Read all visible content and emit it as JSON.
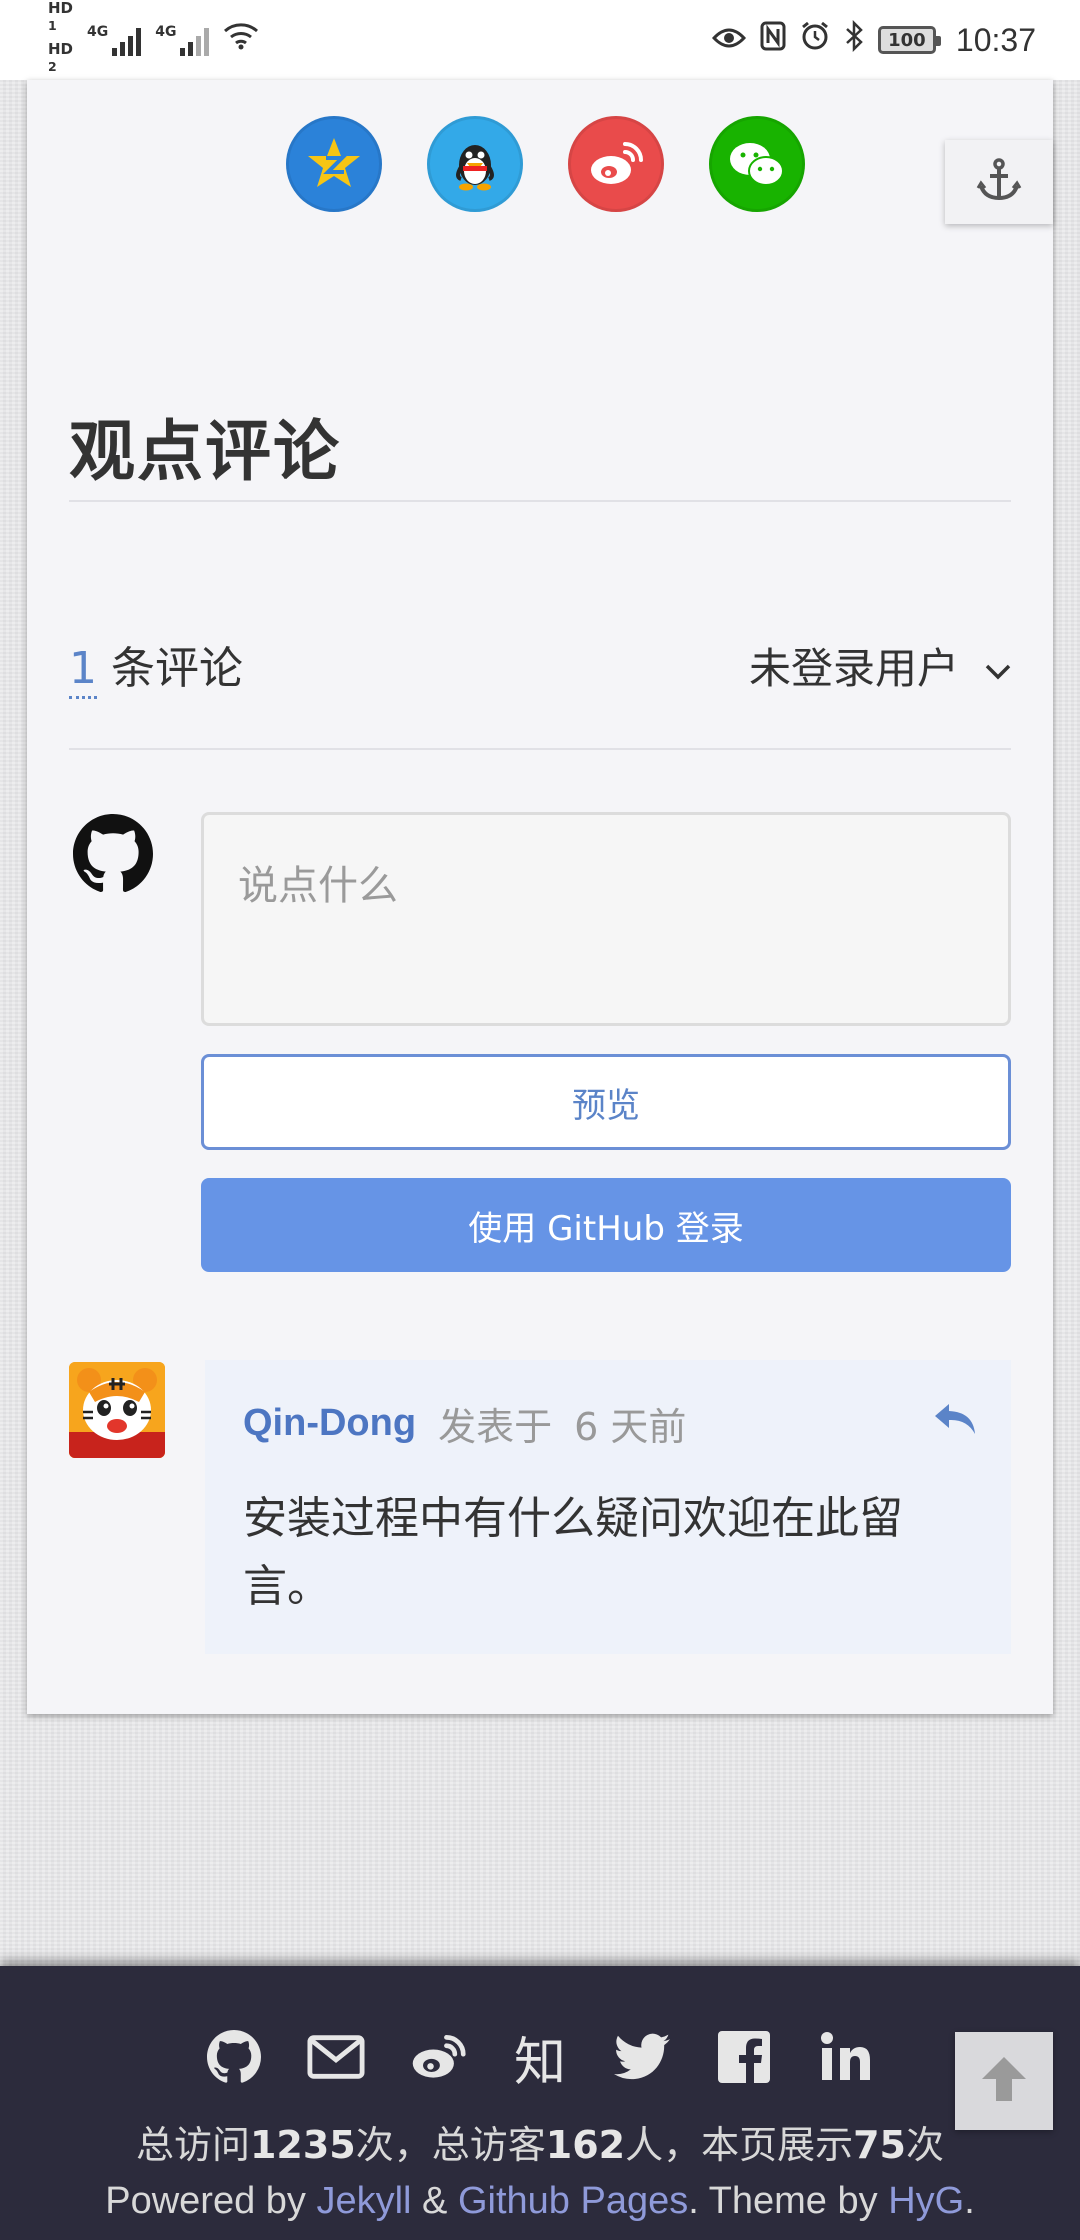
{
  "status_bar": {
    "hd1": "HD",
    "hd1_sub": "1",
    "hd2": "HD",
    "hd2_sub": "2",
    "net1": "4G",
    "net2": "4G",
    "battery": "100",
    "time": "10:37"
  },
  "share_icons": [
    "qzone-icon",
    "qq-icon",
    "weibo-icon",
    "wechat-icon"
  ],
  "comments_section": {
    "title": "观点评论",
    "count_number": "1",
    "count_label": "条评论",
    "user_menu_label": "未登录用户",
    "input_placeholder": "说点什么",
    "preview_button": "预览",
    "login_button": "使用 GitHub 登录"
  },
  "comments": [
    {
      "author": "Qin-Dong",
      "posted_label": "发表于",
      "time_ago": "6 天前",
      "body": "安装过程中有什么疑问欢迎在此留言。"
    }
  ],
  "footer": {
    "social_icons": [
      "github-icon",
      "mail-icon",
      "weibo-icon",
      "zhihu-icon",
      "twitter-icon",
      "facebook-icon",
      "linkedin-icon"
    ],
    "zhihu_glyph": "知",
    "stats": {
      "prefix1": "总访问",
      "total_visits": "1235",
      "suffix1": "次，总访客",
      "visitors": "162",
      "suffix2": "人，本页展示",
      "page_views": "75",
      "suffix3": "次"
    },
    "powered": {
      "prefix": "Powered by ",
      "jekyll": "Jekyll",
      "amp": " & ",
      "github_pages": "Github Pages",
      "theme_text": ". Theme by ",
      "hyg": "HyG",
      "end": "."
    }
  },
  "colors": {
    "link": "#5b84c8",
    "login_button": "#6694e6",
    "footer_bg": "#2c2b3c",
    "footer_link": "#8f9ad9"
  }
}
